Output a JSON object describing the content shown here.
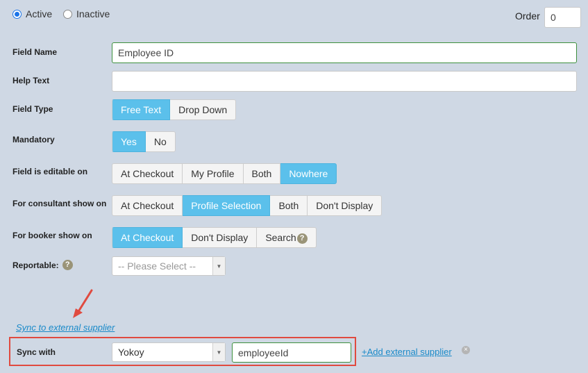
{
  "status": {
    "active_label": "Active",
    "inactive_label": "Inactive",
    "selected": "Active"
  },
  "order": {
    "label": "Order",
    "value": "0"
  },
  "field_name": {
    "label": "Field Name",
    "value": "Employee ID"
  },
  "help_text": {
    "label": "Help Text",
    "value": ""
  },
  "field_type": {
    "label": "Field Type",
    "options": [
      "Free Text",
      "Drop Down"
    ],
    "selected": "Free Text"
  },
  "mandatory": {
    "label": "Mandatory",
    "options": [
      "Yes",
      "No"
    ],
    "selected": "Yes"
  },
  "editable_on": {
    "label": "Field is editable on",
    "options": [
      "At Checkout",
      "My Profile",
      "Both",
      "Nowhere"
    ],
    "selected": "Nowhere"
  },
  "consultant_show": {
    "label": "For consultant show on",
    "options": [
      "At Checkout",
      "Profile Selection",
      "Both",
      "Don't Display"
    ],
    "selected": "Profile Selection"
  },
  "booker_show": {
    "label": "For booker show on",
    "options": [
      "At Checkout",
      "Don't Display",
      "Search"
    ],
    "selected": "At Checkout",
    "help_glyph": "?"
  },
  "reportable": {
    "label": "Reportable:",
    "help_glyph": "?",
    "value": "-- Please Select --"
  },
  "sync_link": "Sync to external supplier",
  "sync": {
    "label": "Sync with",
    "supplier": "Yokoy",
    "field_value": "employeeId",
    "add_link": "+Add external supplier"
  },
  "colors": {
    "accent": "#5bc0eb",
    "link": "#1a8ac9",
    "highlight": "#e04a3f",
    "background": "#cfd8e4"
  },
  "icons": [
    "radio-selected-icon",
    "radio-unselected-icon",
    "help-icon",
    "dropdown-arrow-icon",
    "remove-icon",
    "annotation-arrow-icon"
  ]
}
